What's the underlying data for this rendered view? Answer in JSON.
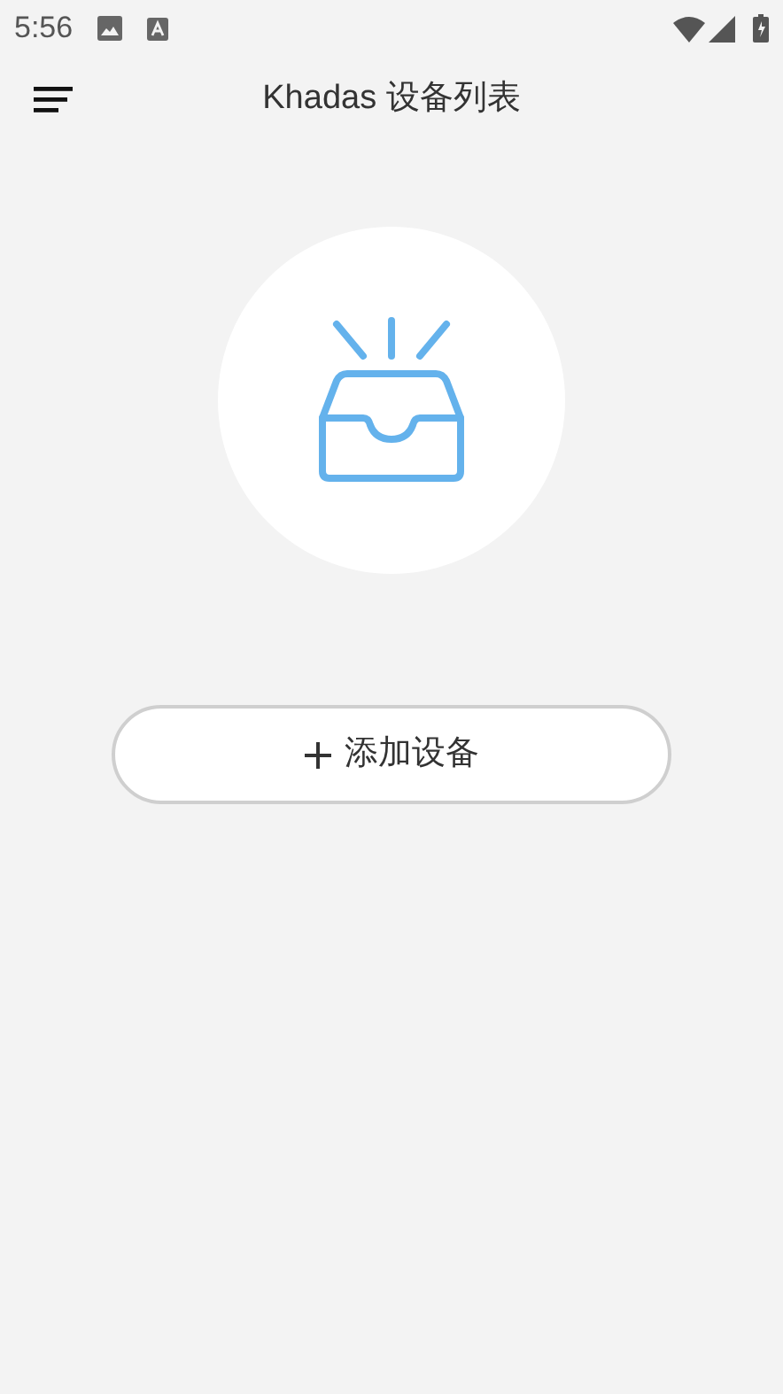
{
  "status_bar": {
    "time": "5:56"
  },
  "app_bar": {
    "title": "Khadas 设备列表"
  },
  "add_button": {
    "label": "添加设备"
  }
}
